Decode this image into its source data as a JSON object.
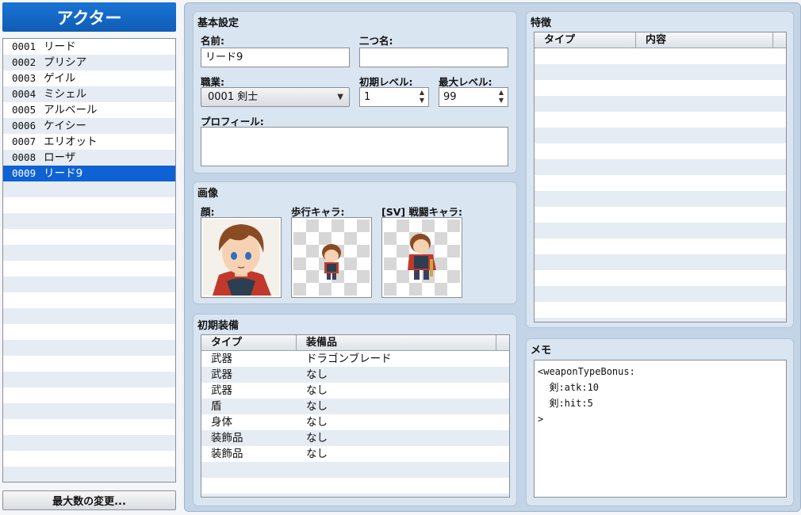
{
  "left": {
    "header": "アクター",
    "actors": [
      {
        "num": "0001",
        "name": "リード"
      },
      {
        "num": "0002",
        "name": "プリシア"
      },
      {
        "num": "0003",
        "name": "ゲイル"
      },
      {
        "num": "0004",
        "name": "ミシェル"
      },
      {
        "num": "0005",
        "name": "アルベール"
      },
      {
        "num": "0006",
        "name": "ケイシー"
      },
      {
        "num": "0007",
        "name": "エリオット"
      },
      {
        "num": "0008",
        "name": "ローザ"
      },
      {
        "num": "0009",
        "name": "リード9"
      }
    ],
    "selected_index": 8,
    "max_button": "最大数の変更..."
  },
  "basic": {
    "title": "基本設定",
    "name_label": "名前:",
    "name_value": "リード9",
    "nickname_label": "二つ名:",
    "nickname_value": "",
    "class_label": "職業:",
    "class_value": "0001 剣士",
    "initial_level_label": "初期レベル:",
    "initial_level_value": "1",
    "max_level_label": "最大レベル:",
    "max_level_value": "99",
    "profile_label": "プロフィール:",
    "profile_value": ""
  },
  "images": {
    "title": "画像",
    "face_label": "顔:",
    "character_label": "歩行キャラ:",
    "battler_label": "[SV] 戦闘キャラ:"
  },
  "equipment": {
    "title": "初期装備",
    "col_type": "タイプ",
    "col_item": "装備品",
    "rows": [
      {
        "type": "武器",
        "item": "ドラゴンブレード"
      },
      {
        "type": "武器",
        "item": "なし"
      },
      {
        "type": "武器",
        "item": "なし"
      },
      {
        "type": "盾",
        "item": "なし"
      },
      {
        "type": "身体",
        "item": "なし"
      },
      {
        "type": "装飾品",
        "item": "なし"
      },
      {
        "type": "装飾品",
        "item": "なし"
      }
    ]
  },
  "traits": {
    "title": "特徴",
    "col_type": "タイプ",
    "col_content": "内容"
  },
  "memo": {
    "title": "メモ",
    "lines": [
      "<weaponTypeBonus:",
      "  剣:atk:10",
      "  剣:hit:5",
      ">"
    ]
  },
  "icons": {
    "dropdown": "chevron-down-icon",
    "spinner": "spinner-arrows-icon"
  },
  "colors": {
    "accent": "#1565c0",
    "selected_row": "#0f62d4",
    "panel": "#c2d4e6"
  }
}
